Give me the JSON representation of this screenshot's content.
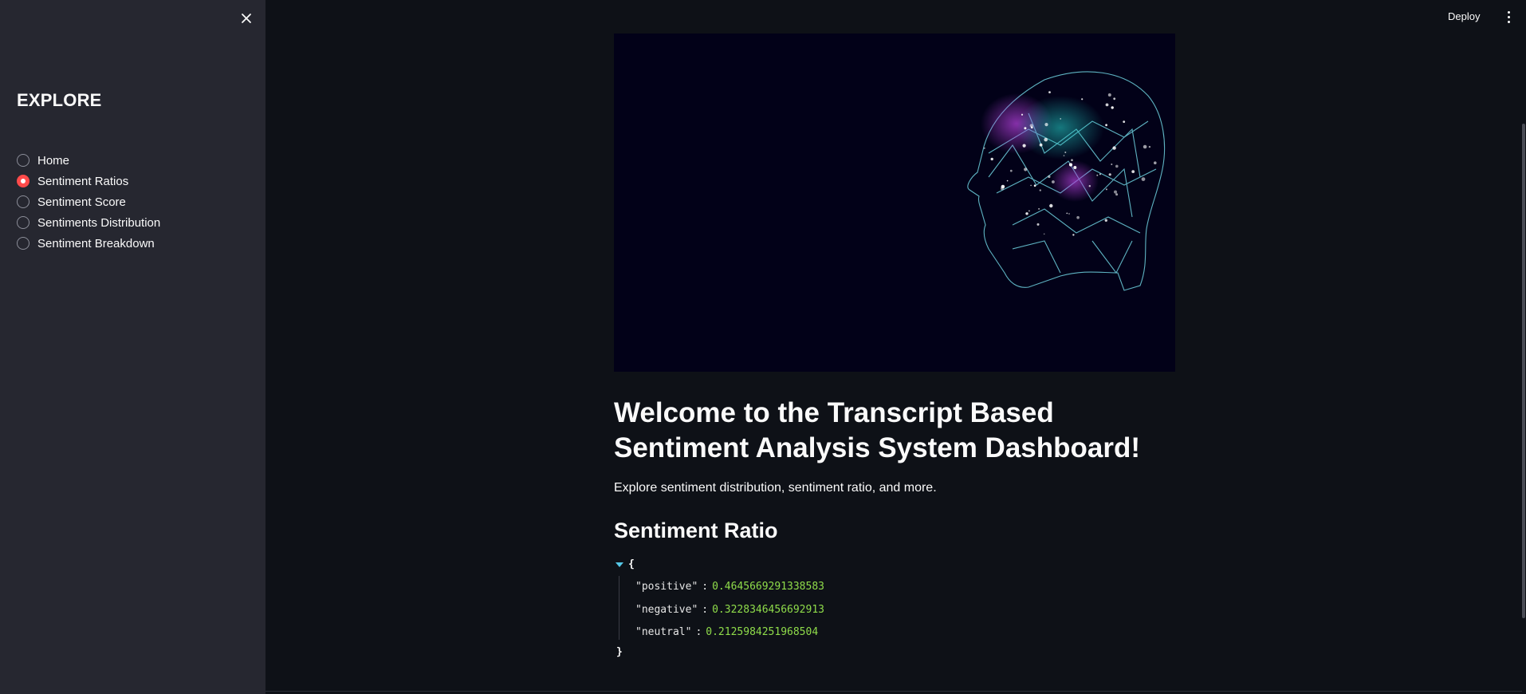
{
  "sidebar": {
    "title": "EXPLORE",
    "items": [
      {
        "label": "Home",
        "selected": false
      },
      {
        "label": "Sentiment Ratios",
        "selected": true
      },
      {
        "label": "Sentiment Score",
        "selected": false
      },
      {
        "label": "Sentiments Distribution",
        "selected": false
      },
      {
        "label": "Sentiment Breakdown",
        "selected": false
      }
    ]
  },
  "header": {
    "deploy_label": "Deploy"
  },
  "main": {
    "hero_image": "sound-wave-and-polygonal-brain-head-illustration",
    "title": "Welcome to the Transcript Based Sentiment Analysis System Dashboard!",
    "subtitle": "Explore sentiment distribution, sentiment ratio, and more.",
    "section_title": "Sentiment Ratio",
    "json": {
      "open_brace": "{",
      "close_brace": "}",
      "entries": [
        {
          "key": "\"positive\"",
          "value": "0.4645669291338583"
        },
        {
          "key": "\"negative\"",
          "value": "0.3228346456692913"
        },
        {
          "key": "\"neutral\"",
          "value": "0.2125984251968504"
        }
      ]
    }
  },
  "colors": {
    "app_bg": "#0e1117",
    "sidebar_bg": "#262730",
    "accent_radio": "#ff4b4b",
    "json_value": "#8fdc4a",
    "json_caret": "#55c7e6"
  }
}
